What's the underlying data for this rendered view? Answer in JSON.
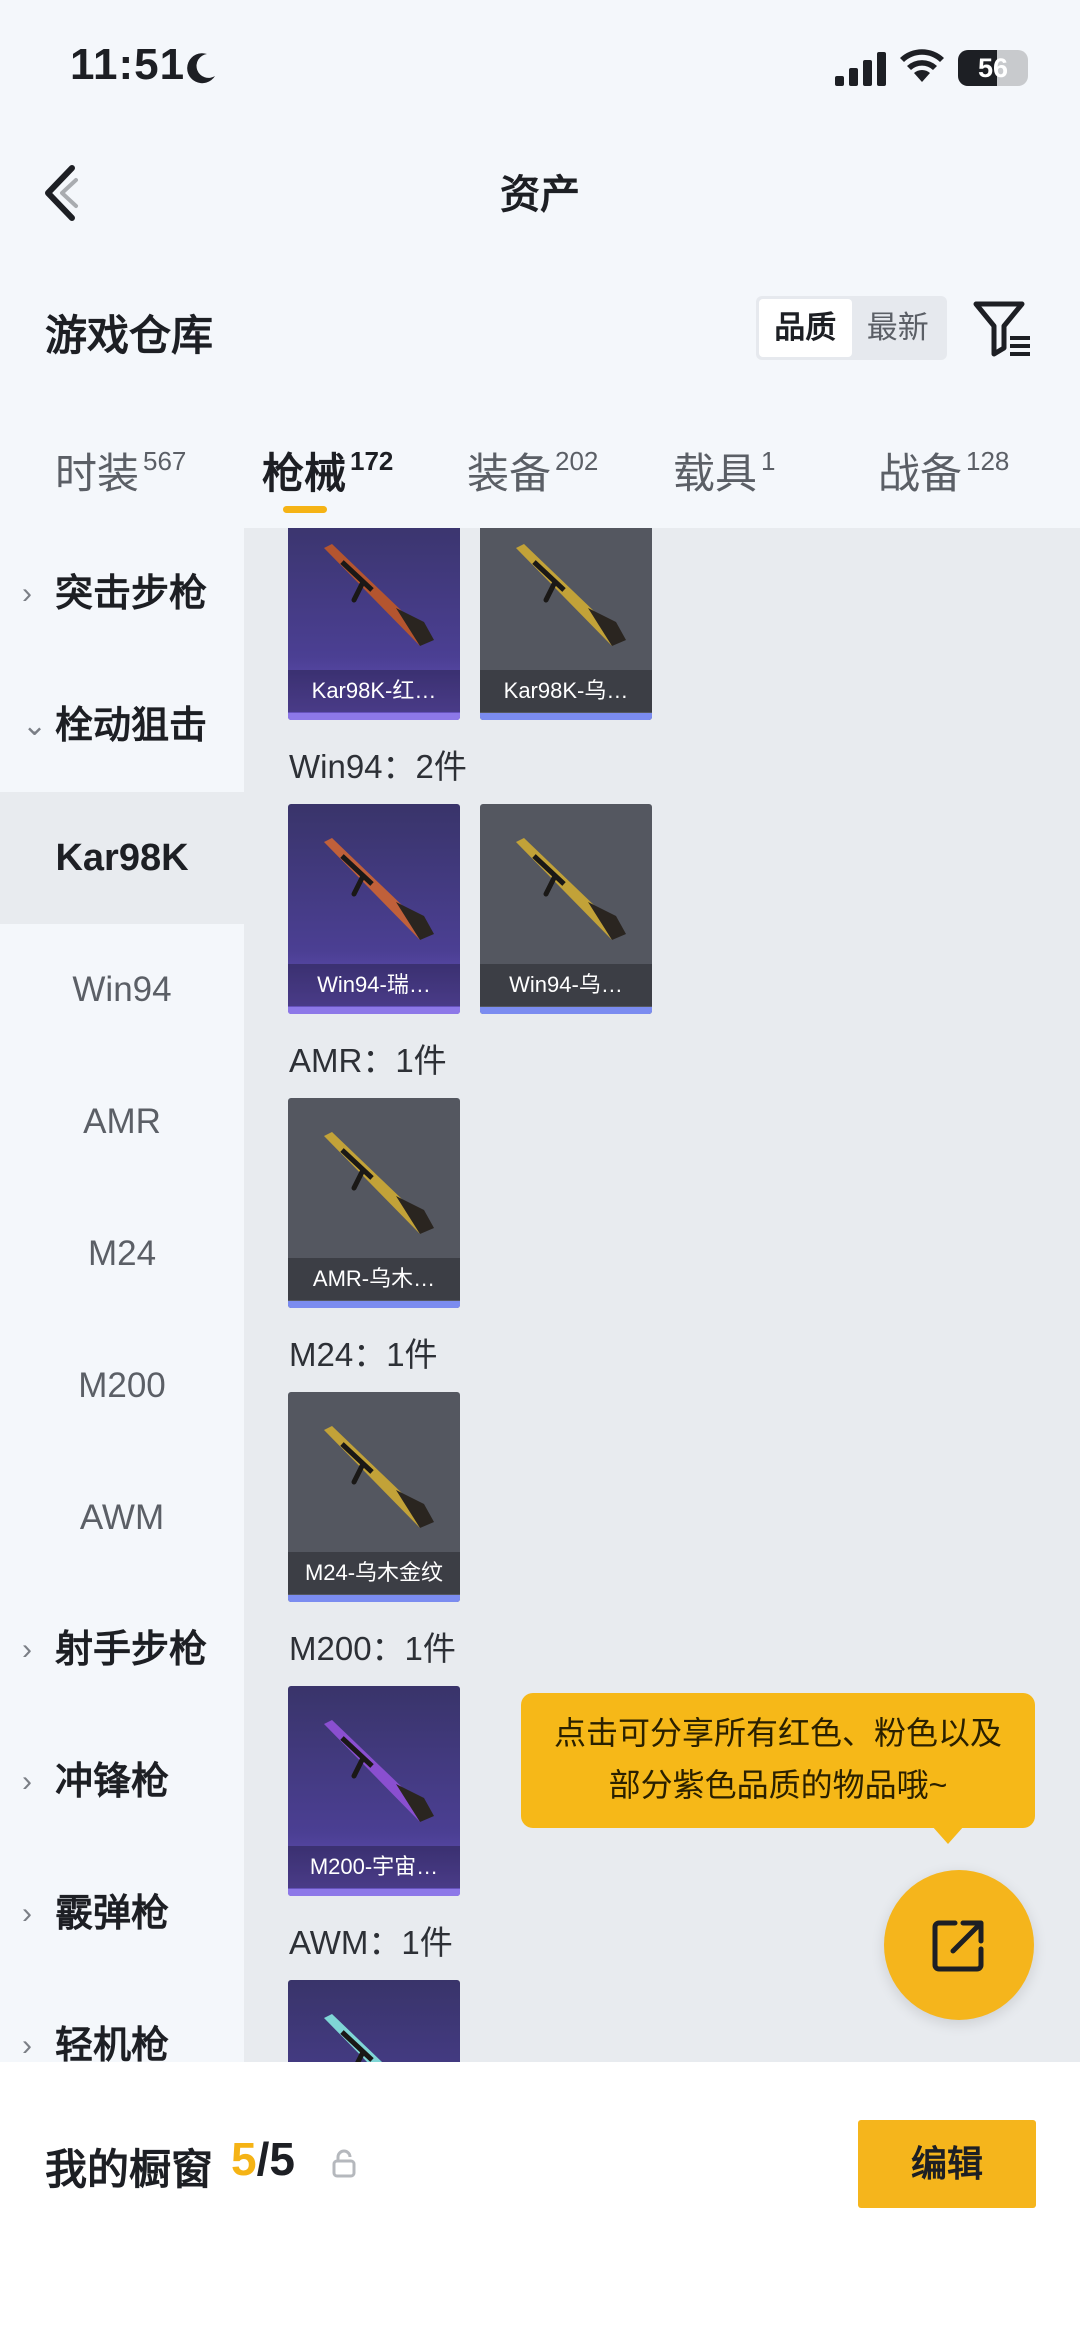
{
  "status_bar": {
    "time": "11:51",
    "battery": "56",
    "battery_level": 0.56
  },
  "header": {
    "title": "资产"
  },
  "warehouse": {
    "title": "游戏仓库",
    "sort_options": [
      "品质",
      "最新"
    ],
    "sort_selected": "品质"
  },
  "tabs": [
    {
      "label": "时装",
      "count": "567"
    },
    {
      "label": "枪械",
      "count": "172"
    },
    {
      "label": "装备",
      "count": "202"
    },
    {
      "label": "载具",
      "count": "1"
    },
    {
      "label": "战备",
      "count": "128"
    }
  ],
  "active_tab": "枪械",
  "sidebar": {
    "items": [
      {
        "label": "突击步枪",
        "chevron": "›"
      },
      {
        "label": "栓动狙击",
        "chevron": "⌄"
      },
      {
        "label": "Kar98K"
      },
      {
        "label": "Win94"
      },
      {
        "label": "AMR"
      },
      {
        "label": "M24"
      },
      {
        "label": "M200"
      },
      {
        "label": "AWM"
      },
      {
        "label": "射手步枪",
        "chevron": "›"
      },
      {
        "label": "冲锋枪",
        "chevron": "›"
      },
      {
        "label": "霰弹枪",
        "chevron": "›"
      },
      {
        "label": "轻机枪",
        "chevron": "›"
      }
    ]
  },
  "groups": [
    {
      "label": "",
      "items": [
        {
          "name": "Kar98K-红…",
          "rarity": "purple",
          "gun_color": "#b4552f"
        },
        {
          "name": "Kar98K-乌…",
          "rarity": "grey",
          "gun_color": "#c2a238"
        }
      ]
    },
    {
      "label": "Win94：2件",
      "items": [
        {
          "name": "Win94-瑞…",
          "rarity": "purple",
          "gun_color": "#c0603a"
        },
        {
          "name": "Win94-乌…",
          "rarity": "grey",
          "gun_color": "#c2a238"
        }
      ]
    },
    {
      "label": "AMR：1件",
      "items": [
        {
          "name": "AMR-乌木…",
          "rarity": "grey",
          "gun_color": "#c2a238"
        }
      ]
    },
    {
      "label": "M24：1件",
      "items": [
        {
          "name": "M24-乌木金纹",
          "rarity": "grey",
          "gun_color": "#c2a238"
        }
      ]
    },
    {
      "label": "M200：1件",
      "items": [
        {
          "name": "M200-宇宙…",
          "rarity": "purple",
          "gun_color": "#8a4fd0"
        }
      ]
    },
    {
      "label": "AWM：1件",
      "items": [
        {
          "name": "",
          "rarity": "purple",
          "gun_color": "#7fd6d6"
        }
      ]
    }
  ],
  "tooltip": {
    "line1": "点击可分享所有红色、粉色以及",
    "line2": "部分紫色品质的物品哦~"
  },
  "bottom": {
    "label": "我的橱窗",
    "current": "5",
    "separator": "/",
    "total": "5",
    "edit": "编辑"
  },
  "colors": {
    "accent": "#f5b315",
    "purple_card": "#4b3f93",
    "grey_card": "#545760"
  }
}
